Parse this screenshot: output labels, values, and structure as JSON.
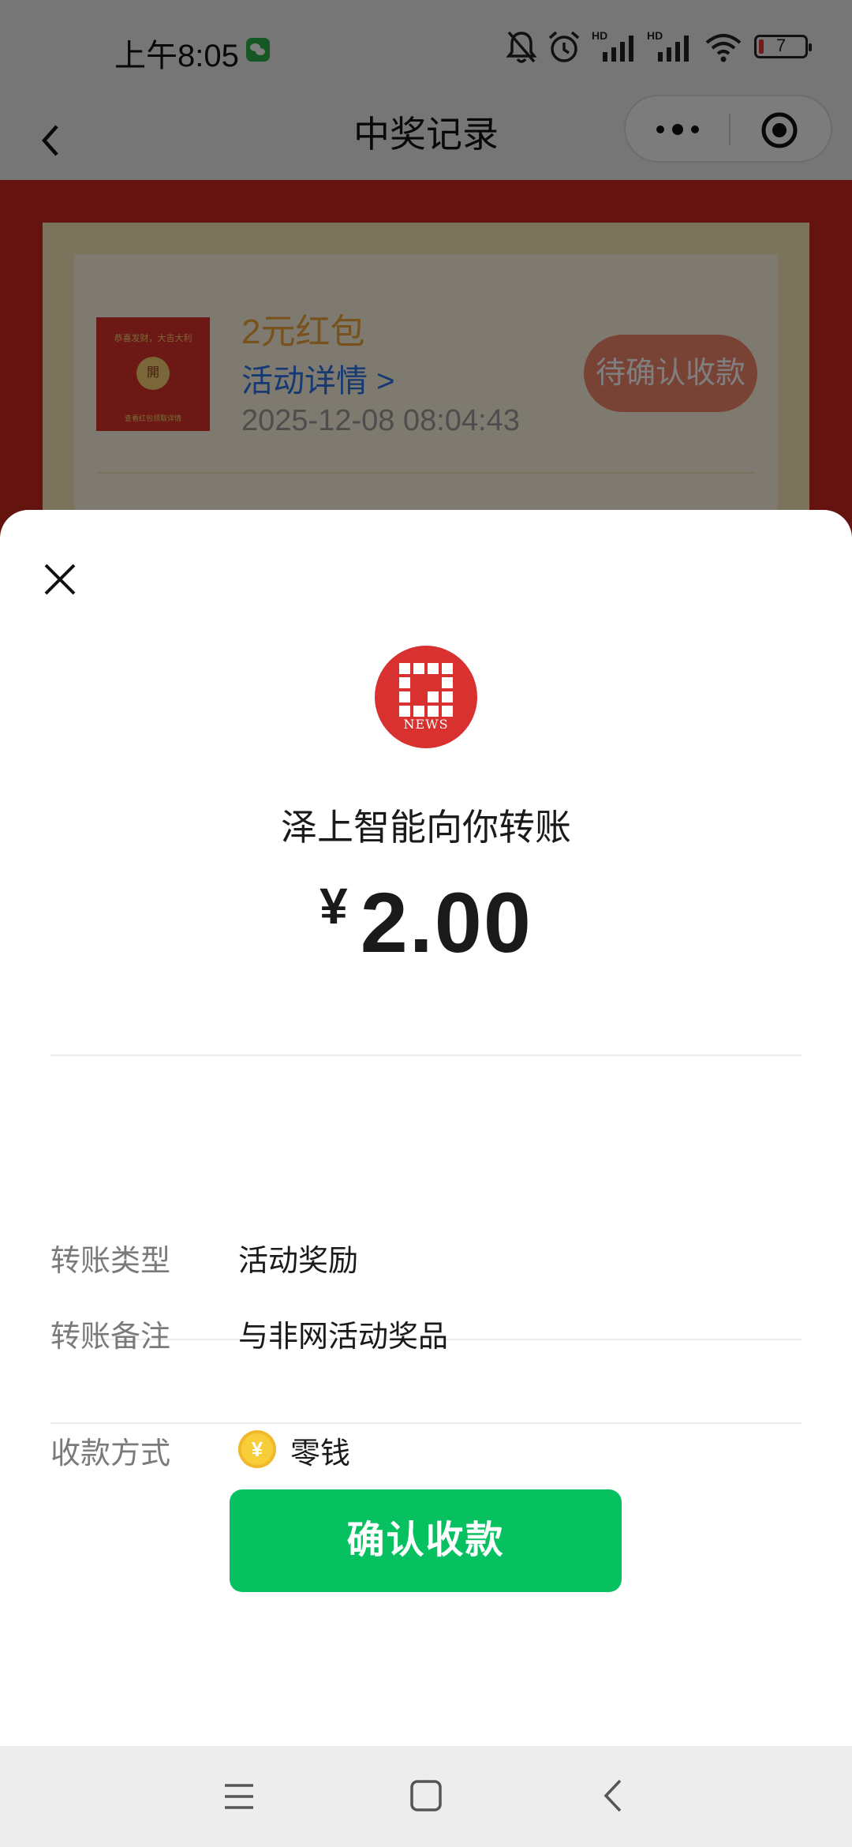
{
  "status_bar": {
    "time": "上午8:05",
    "battery_level": "7",
    "icons": [
      "wechat-icon",
      "bell-off-icon",
      "alarm-icon",
      "signal-hd-icon",
      "signal-hd-icon",
      "wifi-icon",
      "battery-icon"
    ]
  },
  "navbar": {
    "title": "中奖记录",
    "back_icon": "chevron-left-icon",
    "more_icon": "more-dots-icon",
    "close_icon": "target-circle-icon"
  },
  "background_record": {
    "thumb_top_text": "恭喜发财，大吉大利",
    "thumb_center_text": "開",
    "thumb_bottom_text": "查看红包领取详情",
    "title": "2元红包",
    "link": "活动详情 >",
    "time": "2025-12-08 08:04:43",
    "status_button": "待确认收款"
  },
  "sheet": {
    "close_icon": "close-icon",
    "logo_text": "NEWS",
    "sender_line": "泽上智能向你转账",
    "currency": "¥",
    "amount": "2.00",
    "rows": [
      {
        "label": "转账类型",
        "value": "活动奖励"
      },
      {
        "label": "转账备注",
        "value": "与非网活动奖品"
      },
      {
        "label": "收款方式",
        "value": "零钱"
      }
    ],
    "coin_symbol": "¥",
    "confirm_button": "确认收款"
  },
  "colors": {
    "accent_green": "#07c160",
    "page_red": "#c8261c",
    "link_blue": "#2b73e6",
    "prize_orange": "#f2a23a"
  },
  "system_nav": {
    "icons": [
      "menu-icon",
      "home-icon",
      "back-icon"
    ]
  }
}
